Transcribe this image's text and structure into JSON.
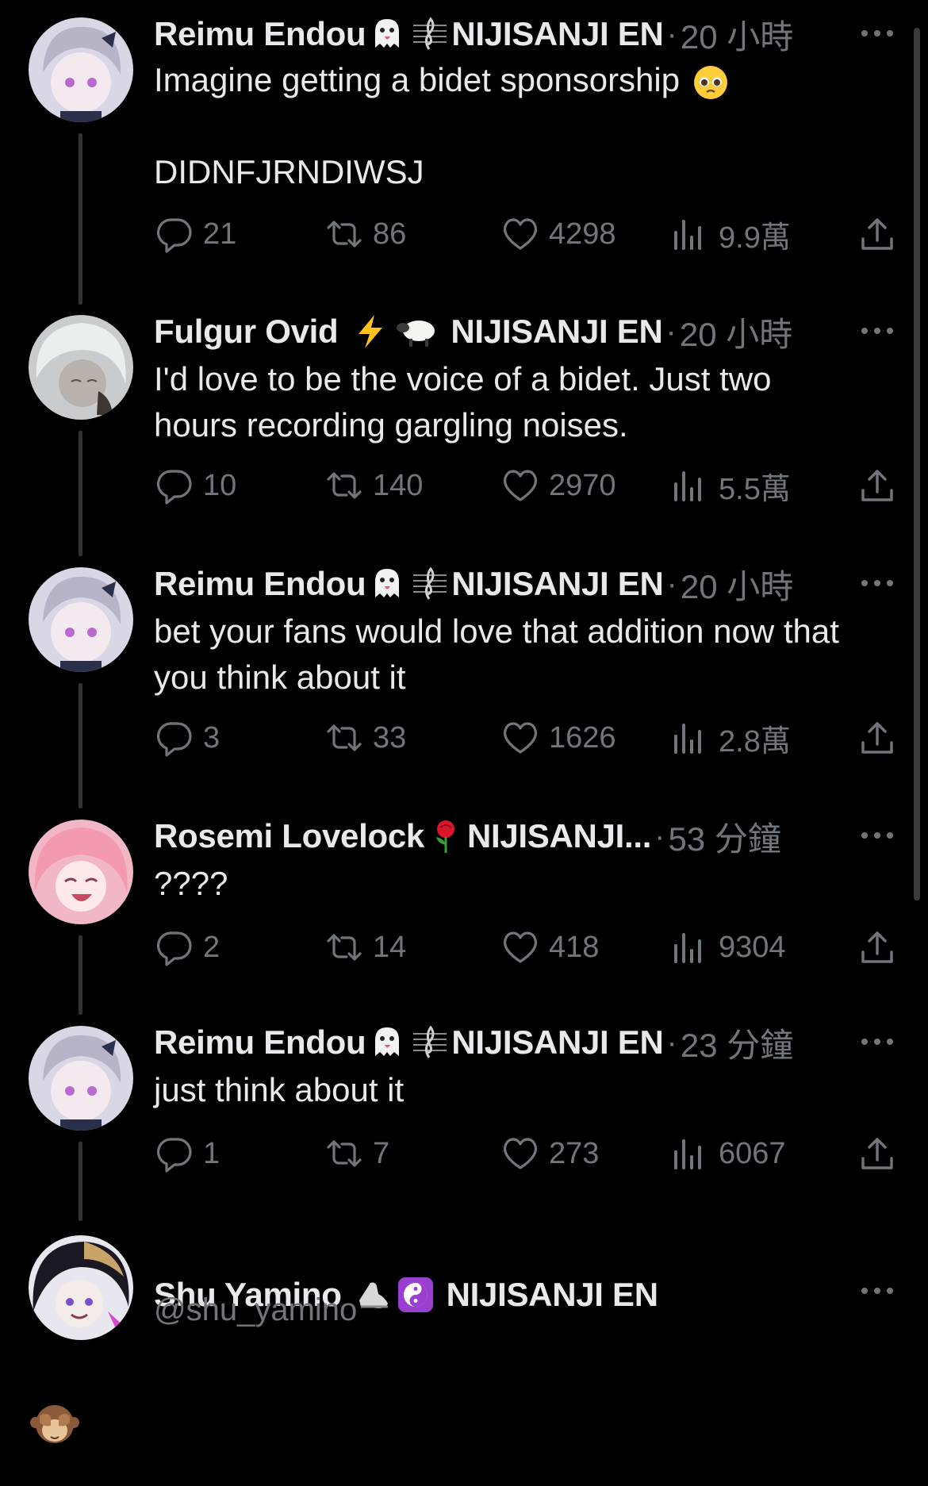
{
  "tweets": [
    {
      "display_name": "Reimu Endou",
      "name_emoji": "ghost-emoji",
      "name_emoji2": "music-score-emoji",
      "affiliation": "NIJISANJI EN",
      "time": "20 小時",
      "text": "Imagine getting a bidet sponsorship",
      "text_emoji": "pleading-face-emoji",
      "text2": "DIDNFJRNDIWSJ",
      "replies": "21",
      "retweets": "86",
      "likes": "4298",
      "views": "9.9萬"
    },
    {
      "display_name": "Fulgur Ovid",
      "name_emoji": "lightning-emoji",
      "name_emoji2": "sheep-emoji",
      "affiliation": "NIJISANJI EN",
      "time": "20 小時",
      "text": "I'd love to be the voice of a bidet. Just two hours recording gargling noises.",
      "replies": "10",
      "retweets": "140",
      "likes": "2970",
      "views": "5.5萬"
    },
    {
      "display_name": "Reimu Endou",
      "name_emoji": "ghost-emoji",
      "name_emoji2": "music-score-emoji",
      "affiliation": "NIJISANJI EN",
      "time": "20 小時",
      "text": "bet your fans would love that addition now that you think about it",
      "replies": "3",
      "retweets": "33",
      "likes": "1626",
      "views": "2.8萬"
    },
    {
      "display_name": "Rosemi Lovelock",
      "name_emoji": "rose-emoji",
      "affiliation": "NIJISANJI...",
      "time": "53 分鐘",
      "text": "????",
      "replies": "2",
      "retweets": "14",
      "likes": "418",
      "views": "9304"
    },
    {
      "display_name": "Reimu Endou",
      "name_emoji": "ghost-emoji",
      "name_emoji2": "music-score-emoji",
      "affiliation": "NIJISANJI EN",
      "time": "23 分鐘",
      "text": "just think about it",
      "replies": "1",
      "retweets": "7",
      "likes": "273",
      "views": "6067"
    }
  ],
  "main_tweet": {
    "display_name": "Shu Yamino",
    "name_emoji": "shoe-emoji",
    "name_emoji2": "yin-yang-emoji",
    "affiliation": "NIJISANJI EN",
    "handle": "@shu_yamino",
    "text_emoji": "see-no-evil-monkey-emoji"
  },
  "colors": {
    "background": "#000000",
    "text": "#e7e9ea",
    "muted": "#71767b",
    "thread_line": "#2f3336"
  }
}
